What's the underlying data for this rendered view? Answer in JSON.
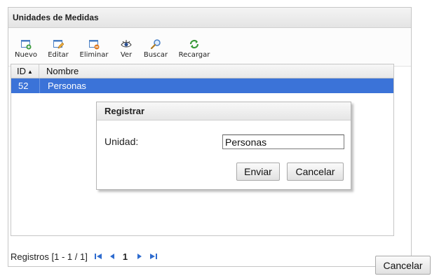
{
  "panel": {
    "title": "Unidades de Medidas"
  },
  "toolbar": {
    "buttons": [
      {
        "label": "Nuevo",
        "icon": "new-window-icon"
      },
      {
        "label": "Editar",
        "icon": "edit-window-icon"
      },
      {
        "label": "Eliminar",
        "icon": "delete-window-icon"
      },
      {
        "label": "Ver",
        "icon": "eye-icon"
      },
      {
        "label": "Buscar",
        "icon": "magnifier-icon"
      },
      {
        "label": "Recargar",
        "icon": "refresh-icon"
      }
    ]
  },
  "grid": {
    "columns": {
      "id": "ID",
      "nombre": "Nombre"
    },
    "sort": "ascending on ID",
    "rows": [
      {
        "id": "52",
        "nombre": "Personas",
        "selected": true
      }
    ]
  },
  "pager": {
    "records": "Registros [1 - 1 / 1]",
    "page": "1"
  },
  "dialog": {
    "title": "Registrar",
    "label": "Unidad:",
    "value": "Personas",
    "submit_label": "Enviar",
    "cancel_label": "Cancelar"
  },
  "outer_cancel_label": "Cancelar",
  "colors": {
    "selection": "#3b73d8",
    "icon_blue": "#4a7fc4",
    "icon_green": "#3a9a3a",
    "icon_orange": "#e07a20"
  }
}
